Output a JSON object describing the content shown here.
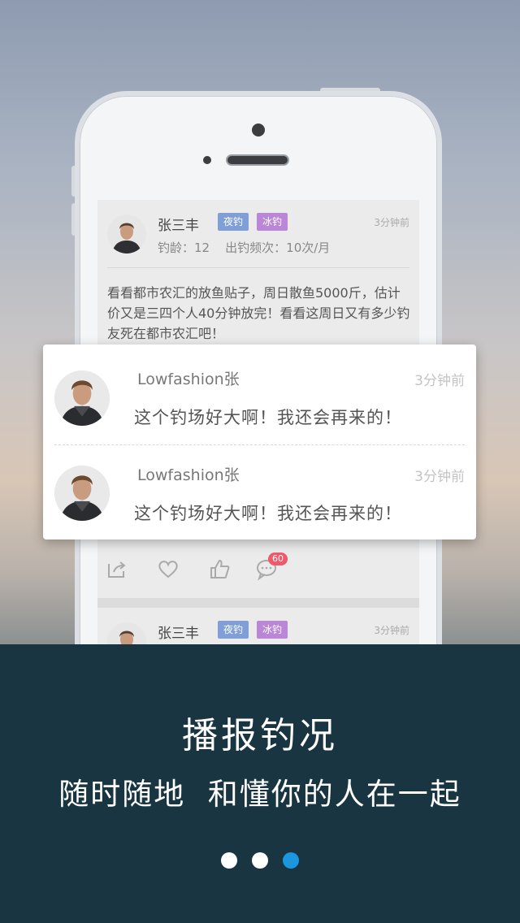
{
  "post": {
    "name": "张三丰",
    "tags": [
      "夜钓",
      "冰钓"
    ],
    "time": "3分钟前",
    "meta": "钓龄：12    出钓频次：10次/月",
    "body": "看看都市农汇的放鱼贴子，周日散鱼5000斤，估计价又是三四个人40分钟放完！看看这周日又有多少钓友死在都市农汇吧！",
    "actions": [
      "share-icon",
      "heart-icon",
      "thumbs-up-icon",
      "comment-icon"
    ],
    "comment_count": "60"
  },
  "post2": {
    "name": "张三丰",
    "tags": [
      "夜钓",
      "冰钓"
    ],
    "time": "3分钟前"
  },
  "comments": [
    {
      "name": "Lowfashion张",
      "time": "3分钟前",
      "text": "这个钓场好大啊！我还会再来的！"
    },
    {
      "name": "Lowfashion张",
      "time": "3分钟前",
      "text": "这个钓场好大啊！我还会再来的！"
    }
  ],
  "banner": {
    "headline": "播报钓况",
    "subline": "随时随地  和懂你的人在一起",
    "page_count": 3,
    "active_page": 3
  },
  "colors": {
    "tag_night": "#7f9fd6",
    "tag_ice": "#b987d6",
    "badge": "#ef5a6a",
    "banner_bg": "#183541",
    "active_dot": "#1b97e0"
  }
}
